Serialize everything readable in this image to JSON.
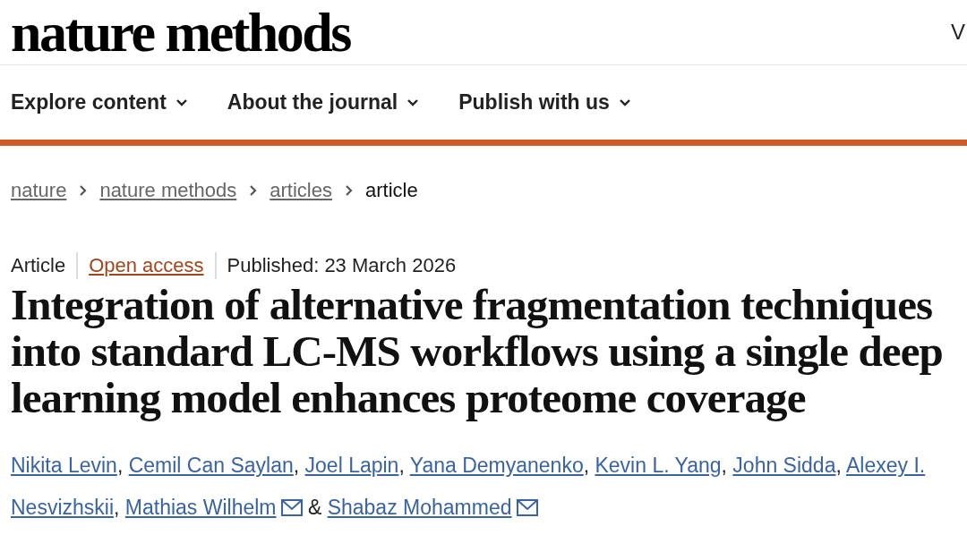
{
  "header": {
    "logo": "nature methods",
    "edge_text": "V"
  },
  "nav": [
    {
      "label": "Explore content"
    },
    {
      "label": "About the journal"
    },
    {
      "label": "Publish with us"
    }
  ],
  "breadcrumbs": [
    {
      "label": "nature",
      "link": true
    },
    {
      "label": "nature methods",
      "link": true
    },
    {
      "label": "articles",
      "link": true
    },
    {
      "label": "article",
      "link": false
    }
  ],
  "meta": {
    "type": "Article",
    "access": "Open access",
    "published": "Published: 23 March 2026"
  },
  "title": "Integration of alternative fragmentation techniques into standard LC-MS workflows using a single deep learning model enhances proteome coverage",
  "authors": [
    {
      "kind": "author",
      "name": "Nikita Levin",
      "after": ","
    },
    {
      "kind": "author",
      "name": "Cemil Can Saylan",
      "after": ","
    },
    {
      "kind": "author",
      "name": "Joel Lapin",
      "after": ","
    },
    {
      "kind": "author",
      "name": "Yana Demyanenko",
      "after": ","
    },
    {
      "kind": "author",
      "name": "Kevin L. Yang",
      "after": ","
    },
    {
      "kind": "author",
      "name": "John Sidda",
      "after": ","
    },
    {
      "kind": "author",
      "name_lines": [
        "Alexey I.",
        "Nesvizhskii"
      ],
      "after": ","
    },
    {
      "kind": "author",
      "name": "Mathias Wilhelm",
      "mail": true
    },
    {
      "kind": "separator",
      "text": "&"
    },
    {
      "kind": "author",
      "name": "Shabaz Mohammed",
      "mail": true
    }
  ]
}
